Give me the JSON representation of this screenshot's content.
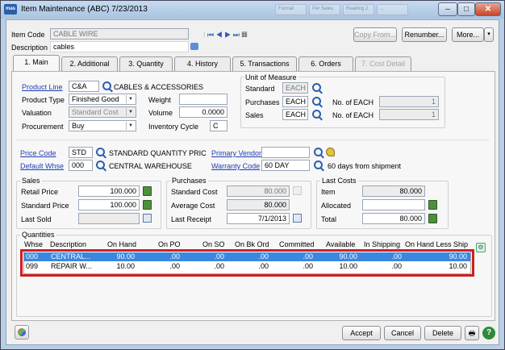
{
  "window": {
    "title": "Item Maintenance (ABC) 7/23/2013",
    "logo": "mas",
    "ghost_tabs": [
      "Format",
      "Per Sales",
      "Reading 2",
      "..."
    ]
  },
  "header": {
    "item_code_label": "Item Code",
    "item_code": "CABLE WIRE",
    "description_label": "Description",
    "description": "cables",
    "copy_from": "Copy From...",
    "renumber": "Renumber...",
    "more": "More..."
  },
  "tabs": [
    {
      "label": "1. Main"
    },
    {
      "label": "2. Additional"
    },
    {
      "label": "3. Quantity"
    },
    {
      "label": "4. History"
    },
    {
      "label": "5. Transactions"
    },
    {
      "label": "6. Orders"
    },
    {
      "label": "7. Cost Detail"
    }
  ],
  "main": {
    "product_line_label": "Product Line",
    "product_line": "C&A",
    "product_line_desc": "CABLES & ACCESSORIES",
    "product_type_label": "Product Type",
    "product_type": "Finished Good",
    "valuation_label": "Valuation",
    "valuation": "Standard Cost",
    "procurement_label": "Procurement",
    "procurement": "Buy",
    "weight_label": "Weight",
    "weight": "",
    "volume_label": "Volume",
    "volume": "0.0000",
    "inventory_cycle_label": "Inventory Cycle",
    "inventory_cycle": "C",
    "uom": {
      "title": "Unit of Measure",
      "standard_label": "Standard",
      "standard": "EACH",
      "purchases_label": "Purchases",
      "purchases": "EACH",
      "sales_label": "Sales",
      "sales": "EACH",
      "no_of_label": "No. of",
      "no_of_unit": "EACH",
      "purchases_qty": "1",
      "sales_qty": "1"
    },
    "price_code_label": "Price Code",
    "price_code": "STD",
    "price_code_desc": "STANDARD QUANTITY PRIC",
    "default_whse_label": "Default Whse",
    "default_whse": "000",
    "default_whse_desc": "CENTRAL WAREHOUSE",
    "primary_vendor_label": "Primary Vendor",
    "primary_vendor": "",
    "warranty_code_label": "Warranty Code",
    "warranty_code": "60 DAY",
    "warranty_desc": "60 days from shipment",
    "sales": {
      "title": "Sales",
      "retail_price_label": "Retail Price",
      "retail_price": "100.000",
      "standard_price_label": "Standard Price",
      "standard_price": "100.000",
      "last_sold_label": "Last Sold",
      "last_sold": ""
    },
    "purchases": {
      "title": "Purchases",
      "standard_cost_label": "Standard Cost",
      "standard_cost": "80.000",
      "average_cost_label": "Average Cost",
      "average_cost": "80.000",
      "last_receipt_label": "Last Receipt",
      "last_receipt": "7/1/2013"
    },
    "last_costs": {
      "title": "Last Costs",
      "item_label": "Item",
      "item": "80.000",
      "allocated_label": "Allocated",
      "allocated": "",
      "total_label": "Total",
      "total": "80.000"
    },
    "quantities": {
      "title": "Quantities",
      "columns": [
        "Whse",
        "Description",
        "On Hand",
        "On PO",
        "On SO",
        "On Bk Ord",
        "Committed",
        "Available",
        "In Shipping",
        "On Hand Less Ship"
      ],
      "rows": [
        [
          "000",
          "CENTRAL...",
          "90.00",
          ".00",
          ".00",
          ".00",
          ".00",
          "90.00",
          ".00",
          "90.00"
        ],
        [
          "099",
          "REPAIR W...",
          "10.00",
          ".00",
          ".00",
          ".00",
          ".00",
          "10.00",
          ".00",
          "10.00"
        ]
      ]
    }
  },
  "footer": {
    "accept": "Accept",
    "cancel": "Cancel",
    "delete": "Delete"
  }
}
